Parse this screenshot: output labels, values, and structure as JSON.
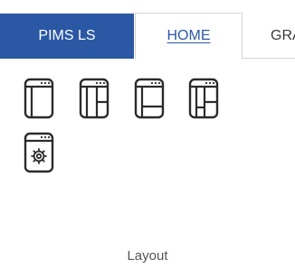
{
  "tabs": {
    "app": "PIMS LS",
    "home": "HOME",
    "next": "GRAPH"
  },
  "ribbon": {
    "group_label": "Layout",
    "buttons": [
      {
        "name": "single-pane-layout-button",
        "icon": "single-pane-layout-icon"
      },
      {
        "name": "split-vertical-layout-button",
        "icon": "split-vertical-layout-icon"
      },
      {
        "name": "split-horizontal-layout-button",
        "icon": "split-horizontal-layout-icon"
      },
      {
        "name": "three-pane-layout-button",
        "icon": "three-pane-layout-icon"
      },
      {
        "name": "layout-settings-button",
        "icon": "window-gear-icon"
      }
    ]
  }
}
